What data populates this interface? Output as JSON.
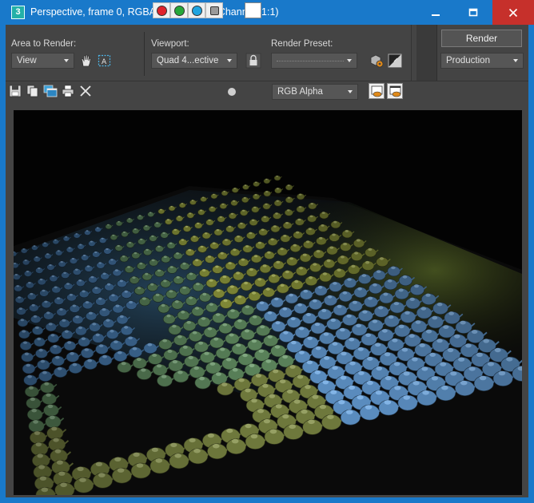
{
  "window": {
    "title": "Perspective, frame 0, RGBA Color 16 Bits/Channel (1:1)",
    "app_icon_glyph": "3",
    "accent": "#1979ca",
    "close_color": "#c6302b"
  },
  "render_panel": {
    "area_label": "Area to Render:",
    "area_value": "View",
    "viewport_label": "Viewport:",
    "viewport_value": "Quad 4...ective",
    "preset_label": "Render Preset:",
    "preset_value": "",
    "render_button": "Render",
    "production_value": "Production"
  },
  "toolbar": {
    "channel_value": "RGB Alpha",
    "channel_colors": {
      "red": "#e0232c",
      "green": "#26a83a",
      "blue": "#1fa4e0"
    }
  },
  "icons": {
    "save": "save-icon",
    "copy": "copy-icon",
    "clone": "clone-window-icon",
    "print": "print-icon",
    "clear": "close-x-icon",
    "lock": "lock-icon",
    "setup": "render-setup-icon",
    "environment": "environment-icon",
    "region": "region-select-icon",
    "hand": "hand-icon"
  }
}
